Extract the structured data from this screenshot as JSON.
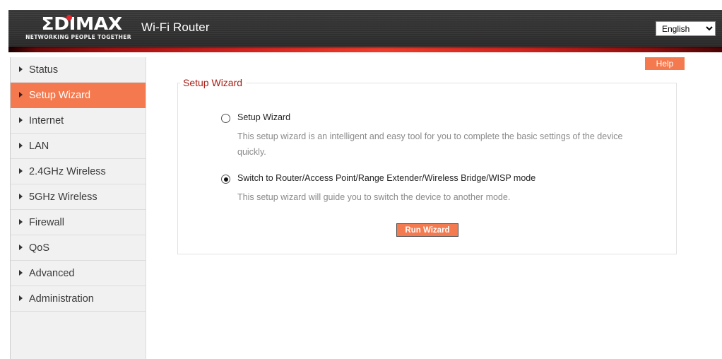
{
  "header": {
    "logo_word": "ΣDIMAX",
    "logo_tagline": "NETWORKING PEOPLE TOGETHER",
    "app_title": "Wi-Fi Router",
    "language": {
      "selected": "English",
      "options": [
        "English"
      ]
    }
  },
  "colors": {
    "accent_orange": "#f4794e",
    "legend_red": "#a61c13",
    "stripe_red": "#ef3b2a",
    "logo_dot_red": "#e8232a",
    "sidebar_bg": "#f1f1f1"
  },
  "sidebar": {
    "items": [
      {
        "label": "Status",
        "active": false
      },
      {
        "label": "Setup Wizard",
        "active": true
      },
      {
        "label": "Internet",
        "active": false
      },
      {
        "label": "LAN",
        "active": false
      },
      {
        "label": "2.4GHz Wireless",
        "active": false
      },
      {
        "label": "5GHz Wireless",
        "active": false
      },
      {
        "label": "Firewall",
        "active": false
      },
      {
        "label": "QoS",
        "active": false
      },
      {
        "label": "Advanced",
        "active": false
      },
      {
        "label": "Administration",
        "active": false
      }
    ]
  },
  "toolbar": {
    "help_label": "Help"
  },
  "main": {
    "panel_legend": "Setup Wizard",
    "options": [
      {
        "title": "Setup Wizard",
        "description": "This setup wizard is an intelligent and easy tool for you to complete the basic settings of the device quickly.",
        "selected": false
      },
      {
        "title": "Switch to Router/Access Point/Range Extender/Wireless Bridge/WISP mode",
        "description": "This setup wizard will guide you to switch the device to another mode.",
        "selected": true
      }
    ],
    "run_wizard_label": "Run Wizard"
  }
}
